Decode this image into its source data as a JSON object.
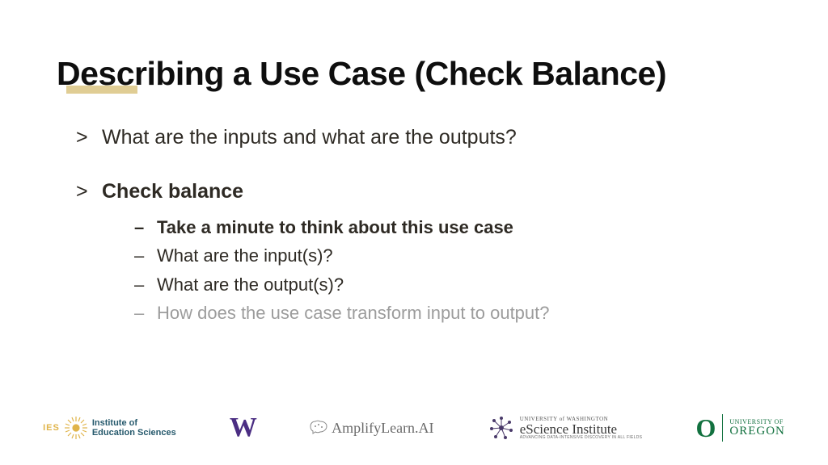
{
  "title": "Describing a Use Case (Check Balance)",
  "bullets": {
    "q1": "What are the inputs and what are the outputs?",
    "head2": "Check balance",
    "sub1": "Take a minute to think about this use case",
    "sub2": "What are the input(s)?",
    "sub3": "What are the output(s)?",
    "sub4": "How does the use case transform input to output?"
  },
  "logos": {
    "ies_letters": "IES",
    "ies_line1": "Institute of",
    "ies_line2": "Education Sciences",
    "uw": "W",
    "amplify": "AmplifyLearn.AI",
    "esci_top": "UNIVERSITY of WASHINGTON",
    "esci_main": "eScience Institute",
    "esci_sub": "ADVANCING DATA-INTENSIVE DISCOVERY IN ALL FIELDS",
    "uo_o": "O",
    "uo_t1": "UNIVERSITY OF",
    "uo_t2": "OREGON"
  }
}
